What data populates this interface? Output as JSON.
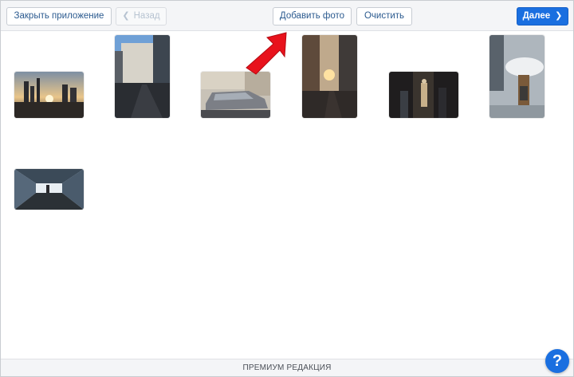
{
  "toolbar": {
    "close_app_label": "Закрыть приложение",
    "back_label": "Назад",
    "add_photo_label": "Добавить фото",
    "clear_label": "Очистить",
    "next_label": "Далее"
  },
  "photos": [
    {
      "subject": "city-skyline-sunset"
    },
    {
      "subject": "street-building-tall"
    },
    {
      "subject": "parked-car-street"
    },
    {
      "subject": "street-sunlight-tall"
    },
    {
      "subject": "people-dark-street"
    },
    {
      "subject": "woman-umbrella-rain"
    },
    {
      "subject": "glass-corridor-bridge"
    }
  ],
  "footer": {
    "edition_label": "ПРЕМИУМ РЕДАКЦИЯ"
  },
  "help": {
    "label": "?"
  },
  "colors": {
    "accent": "#1a6fe0",
    "annotation_arrow": "#e8121c",
    "toolbar_bg": "#f4f5f7"
  },
  "icons": [
    "chevron-left-icon",
    "chevron-right-icon",
    "red-arrow-annotation",
    "help-icon"
  ]
}
